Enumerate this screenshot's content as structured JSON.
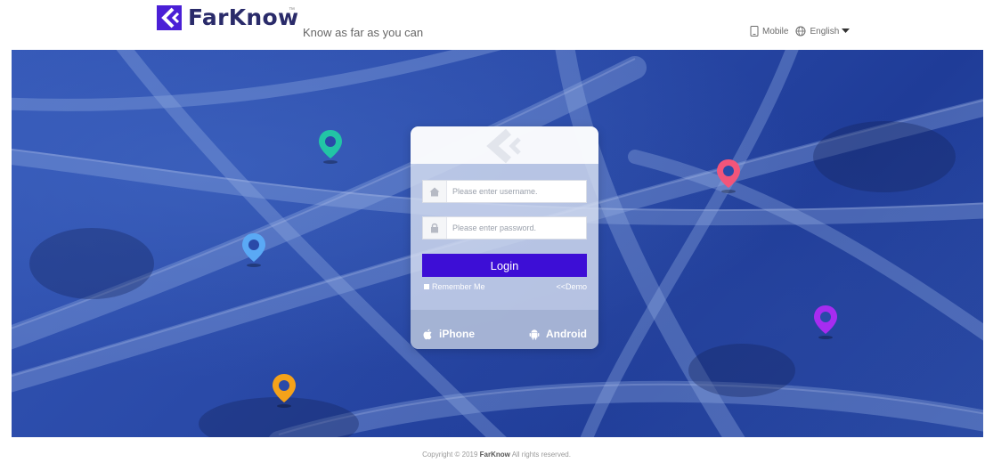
{
  "header": {
    "brand": "FarKnow",
    "trademark": "™",
    "slogan": "Know as far as you can",
    "mobile_label": "Mobile",
    "language_label": "English"
  },
  "login": {
    "username_placeholder": "Please enter username.",
    "password_placeholder": "Please enter password.",
    "login_label": "Login",
    "remember_label": "Remember Me",
    "demo_label": "<<Demo",
    "iphone_label": "iPhone",
    "android_label": "Android"
  },
  "pins": [
    {
      "name": "teal-map-pin",
      "color": "#22c5a5"
    },
    {
      "name": "blue-map-pin",
      "color": "#5aa9f5"
    },
    {
      "name": "orange-map-pin",
      "color": "#f5a21a"
    },
    {
      "name": "pink-map-pin",
      "color": "#f2557a"
    },
    {
      "name": "purple-map-pin",
      "color": "#a72cf0"
    }
  ],
  "footer": {
    "copyright_prefix": "Copyright © 2019 ",
    "copyright_brand": "FarKnow",
    "copyright_suffix": " All rights reserved."
  },
  "colors": {
    "brand_purple": "#3d0ed6",
    "banner_blue": "#2a4aa8"
  }
}
